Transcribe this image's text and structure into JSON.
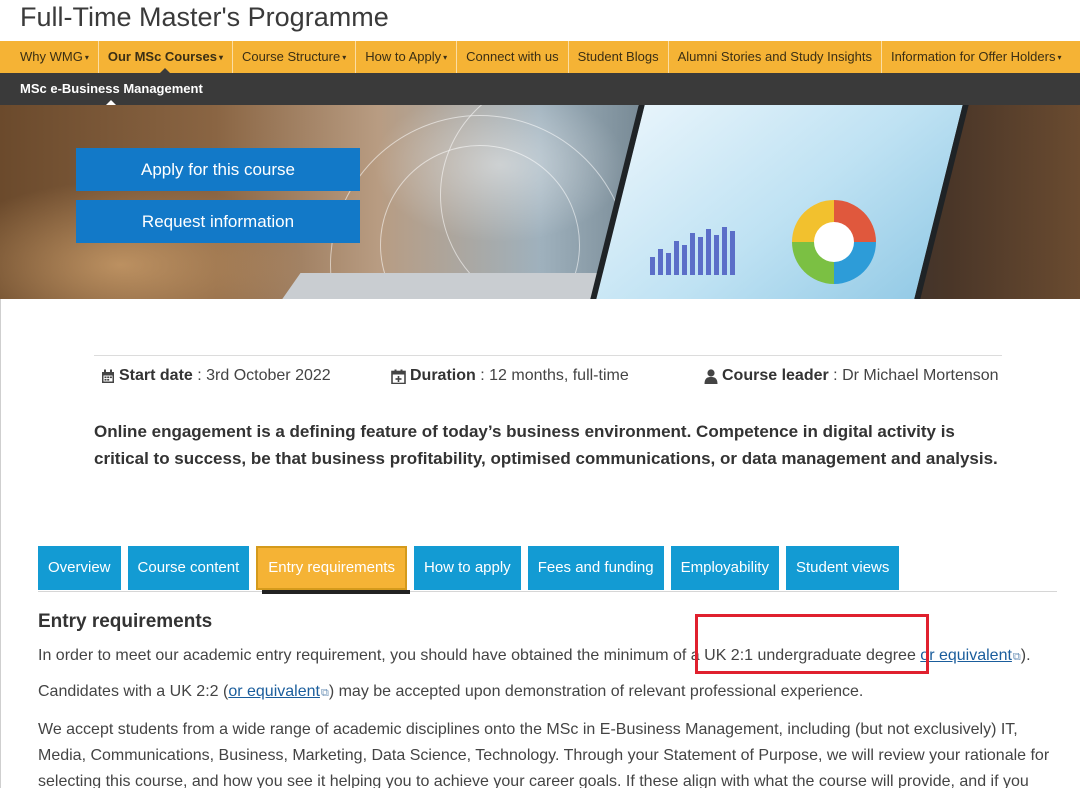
{
  "header": {
    "title": "Full-Time Master's Programme"
  },
  "main_nav": {
    "items": [
      {
        "label": "Why WMG",
        "caret": "▾"
      },
      {
        "label": "Our MSc Courses",
        "caret": "▾"
      },
      {
        "label": "Course Structure",
        "caret": "▾"
      },
      {
        "label": "How to Apply",
        "caret": "▾"
      },
      {
        "label": "Connect with us"
      },
      {
        "label": "Student Blogs"
      },
      {
        "label": "Alumni Stories and Study Insights"
      },
      {
        "label": "Information for Offer Holders",
        "caret": "▾"
      }
    ]
  },
  "sub_nav": {
    "label": "MSc e-Business Management"
  },
  "hero": {
    "apply_label": "Apply for this course",
    "request_label": "Request information"
  },
  "facts": {
    "start": {
      "label": "Start date",
      "separator": " : ",
      "value": "3rd October 2022",
      "icon": "calendar-icon"
    },
    "duration": {
      "label": "Duration",
      "separator": " : ",
      "value": "12 months, full-time",
      "icon": "calendar-plus-icon"
    },
    "leader": {
      "label": "Course leader",
      "separator": " : ",
      "value": "Dr Michael Mortenson",
      "icon": "user-icon"
    }
  },
  "intro": "Online engagement is a defining feature of today’s business environment. Competence in digital activity is critical to success, be that business profitability, optimised communications, or data management and analysis.",
  "tabs": [
    {
      "label": "Overview"
    },
    {
      "label": "Course content"
    },
    {
      "label": "Entry requirements"
    },
    {
      "label": "How to apply"
    },
    {
      "label": "Fees and funding"
    },
    {
      "label": "Employability"
    },
    {
      "label": "Student views"
    }
  ],
  "content": {
    "title": "Entry requirements",
    "p1_before": "In order to meet our academic entry requirement, you should have obtained the minimum of a UK 2:1 undergraduate degree ",
    "p1_link": "or equivalent",
    "p1_after": ").",
    "p2_before": "Candidates with a UK 2:2 (",
    "p2_link": "or equivalent",
    "p2_after": ") may be accepted upon demonstration of relevant professional experience.",
    "p3": "We accept students from a wide range of academic disciplines onto the MSc in E-Business Management, including (but not exclusively) IT, Media, Communications, Business, Marketing, Data Science, Technology. Through your Statement of Purpose, we will review your rationale for selecting this course, and how you see it helping you to achieve your career goals. If these align with what the course will provide, and if you"
  },
  "colors": {
    "nav_bg": "#f5b335",
    "sub_nav_bg": "#3a3a3a",
    "tab_bg": "#139bd3",
    "button_bg": "#1279c8",
    "highlight": "#e0202e"
  }
}
